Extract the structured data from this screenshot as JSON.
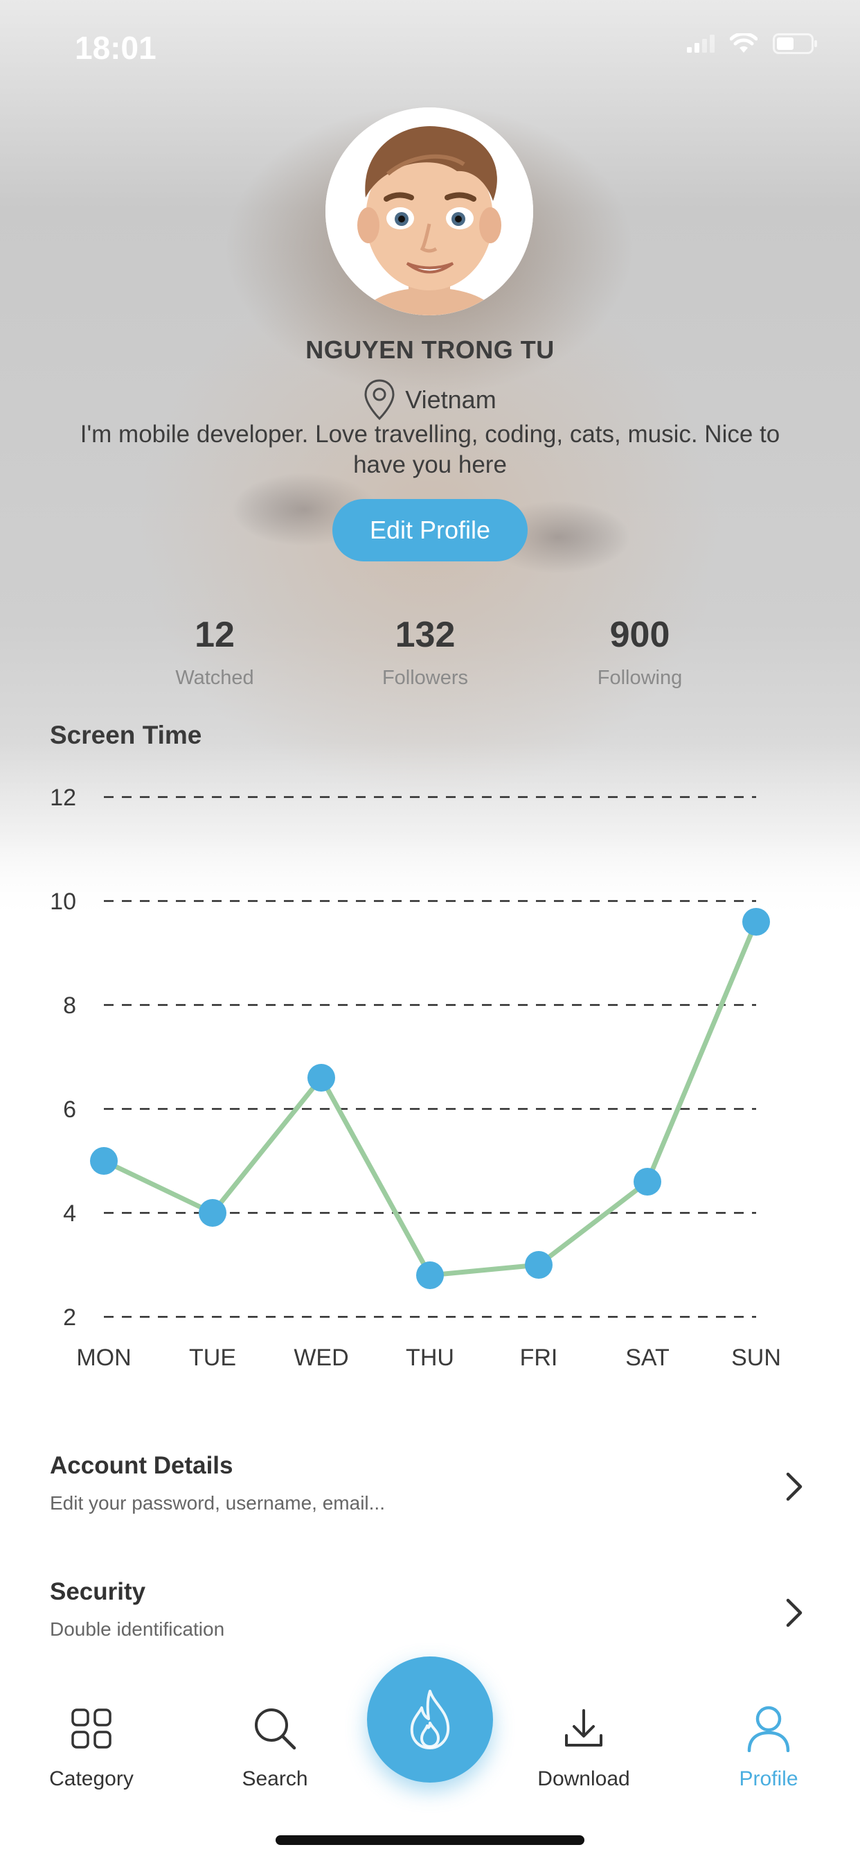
{
  "status_bar": {
    "time": "18:01"
  },
  "profile": {
    "name": "NGUYEN TRONG TU",
    "location": "Vietnam",
    "bio": "I'm mobile developer. Love travelling, coding, cats, music. Nice to have you here",
    "edit_button": "Edit Profile"
  },
  "stats": [
    {
      "value": "12",
      "label": "Watched"
    },
    {
      "value": "132",
      "label": "Followers"
    },
    {
      "value": "900",
      "label": "Following"
    }
  ],
  "screen_time": {
    "title": "Screen Time"
  },
  "chart_data": {
    "type": "line",
    "title": "Screen Time",
    "categories": [
      "MON",
      "TUE",
      "WED",
      "THU",
      "FRI",
      "SAT",
      "SUN"
    ],
    "values": [
      5.0,
      4.0,
      6.6,
      2.8,
      3.0,
      4.6,
      9.6
    ],
    "ylim": [
      2,
      12
    ],
    "yticks": [
      2,
      4,
      6,
      8,
      10,
      12
    ],
    "grid": true,
    "line_color": "#9ccc9f",
    "point_color": "#4aaee0"
  },
  "settings": [
    {
      "title": "Account Details",
      "subtitle": "Edit your password, username, email..."
    },
    {
      "title": "Security",
      "subtitle": "Double identification"
    }
  ],
  "tabs": [
    {
      "label": "Category",
      "icon": "grid-icon",
      "active": false
    },
    {
      "label": "Search",
      "icon": "search-icon",
      "active": false
    },
    {
      "label": "Download",
      "icon": "download-icon",
      "active": false
    },
    {
      "label": "Profile",
      "icon": "person-icon",
      "active": true
    }
  ],
  "fab": {
    "icon": "flame-icon"
  },
  "colors": {
    "accent": "#4aaee0",
    "line": "#9ccc9f",
    "text": "#3a3a3a"
  }
}
